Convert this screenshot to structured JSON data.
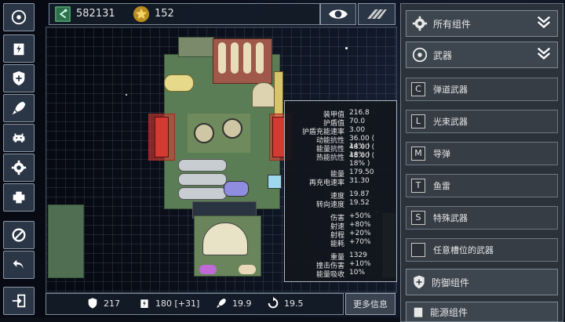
{
  "top": {
    "credits": "582131",
    "stars": "152"
  },
  "bottom": {
    "armor": "217",
    "energy": "180 [+31]",
    "speed": "19.9",
    "turn": "19.5",
    "more_label": "更多信息"
  },
  "categories": [
    {
      "label": "所有组件"
    },
    {
      "label": "武器"
    }
  ],
  "subcategories": [
    {
      "letter": "C",
      "label": "弹道武器"
    },
    {
      "letter": "L",
      "label": "光束武器"
    },
    {
      "letter": "M",
      "label": "导弹"
    },
    {
      "letter": "T",
      "label": "鱼雷"
    },
    {
      "letter": "S",
      "label": "特殊武器"
    },
    {
      "letter": "",
      "label": "任意槽位的武器"
    }
  ],
  "defense_category": {
    "label": "防御组件"
  },
  "bottom_partial": {
    "label": "能源组件"
  },
  "info": {
    "rows": [
      {
        "k": "装甲值",
        "v": "216.8"
      },
      {
        "k": "护盾值",
        "v": "70.0"
      },
      {
        "k": "护盾充能速率",
        "v": "3.00"
      },
      {
        "k": "动能抗性",
        "v": "36.00 ( 14% )"
      },
      {
        "k": "能量抗性",
        "v": "48.00 ( 18% )"
      },
      {
        "k": "热能抗性",
        "v": "48.00 ( 18% )"
      },
      {
        "k": "能量",
        "v": "179.50"
      },
      {
        "k": "再充电速率",
        "v": "31.30"
      },
      {
        "k": "速度",
        "v": "19.87"
      },
      {
        "k": "转向速度",
        "v": "19.52"
      },
      {
        "k": "伤害",
        "v": "+50%"
      },
      {
        "k": "射速",
        "v": "+80%"
      },
      {
        "k": "射程",
        "v": "+20%"
      },
      {
        "k": "能耗",
        "v": "+70%"
      },
      {
        "k": "重量",
        "v": "1329"
      },
      {
        "k": "撞击伤害",
        "v": "+10%"
      },
      {
        "k": "能量吸收",
        "v": "10%"
      }
    ]
  },
  "colors": {
    "accent_green": "#3fa36b",
    "star_gold": "#e8c24a",
    "ship_green": "#5f8a5a",
    "ship_tan": "#cfc7a3",
    "weapon_red": "#d23a32"
  }
}
